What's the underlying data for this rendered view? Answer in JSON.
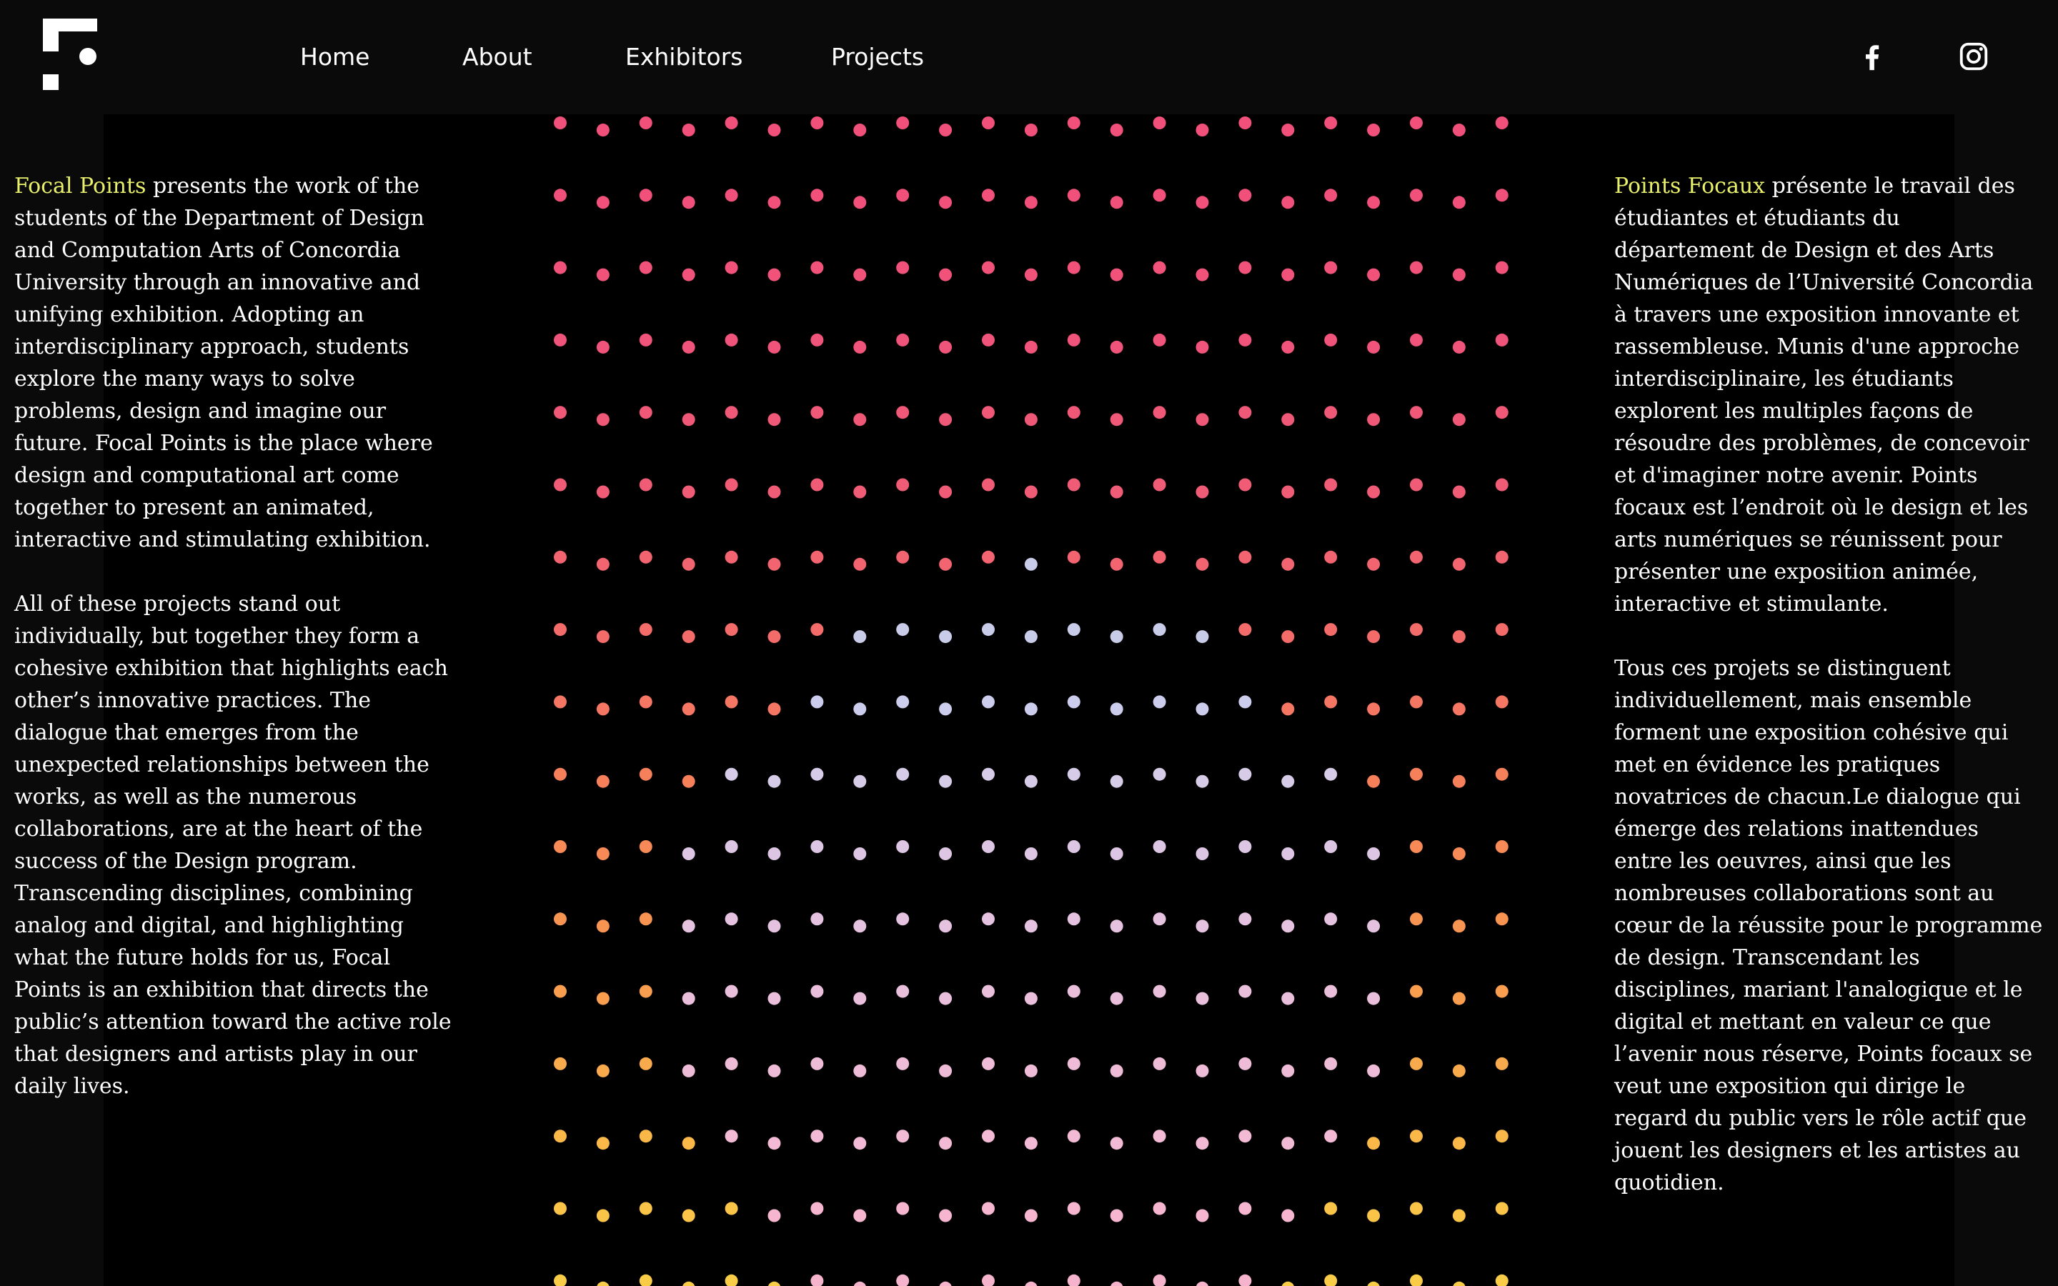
{
  "nav": {
    "logo": "focal-points-logo",
    "links": [
      "Home",
      "About",
      "Exhibitors",
      "Projects"
    ],
    "social": [
      {
        "name": "facebook",
        "icon": "facebook-icon"
      },
      {
        "name": "instagram",
        "icon": "instagram-icon"
      }
    ]
  },
  "left": {
    "highlight": "Focal Points",
    "intro_rest": " presents the work of the students of the Department of Design and Computation Arts of Concordia University through an innovative and unifying exhibition. Adopting an interdisciplinary approach, students explore the many ways to solve problems, design and imagine our future. Focal Points is the place where design and computational art come together to present an animated, interactive and stimulating exhibition.",
    "para2": "All of these projects stand out individually, but together they form a cohesive exhibition that highlights each other’s innovative practices. The dialogue that emerges from the unexpected relationships between the works, as well as the numerous collaborations, are at the heart of the success of the Design program. Transcending disciplines, combining analog and digital, and highlighting what the future holds for us, Focal Points is an exhibition that directs the public’s attention toward the active role that designers and artists play in our daily lives."
  },
  "right": {
    "highlight": "Points Focaux",
    "intro_rest": " présente le travail des étudiantes et étudiants du département de Design et des Arts Numériques de l’Université Concordia à travers une exposition innovante et rassembleuse. Munis d'une approche interdisciplinaire, les étudiants explorent les multiples façons de résoudre des problèmes, de concevoir et d'imaginer notre avenir. Points focaux est l’endroit où le design et les arts numériques se réunissent pour présenter une exposition animée, interactive et stimulante.",
    "para2": "Tous ces projets se distinguent individuellement, mais ensemble forment une exposition cohésive qui met en évidence les pratiques novatrices de chacun.Le dialogue qui émerge des relations inattendues entre les oeuvres, ainsi que les nombreuses collaborations sont au cœur de la réussite pour le programme de design. Transcendant les disciplines, mariant l'analogique et le digital et mettant en valeur ce que l’avenir nous réserve, Points focaux se veut une exposition qui dirige le regard du public vers le rôle actif que jouent les designers et les artistes au quotidien."
  },
  "colors": {
    "background": "#0a0a0a",
    "stage": "#000000",
    "text": "#ffffff",
    "highlight": "#e8f06b",
    "dot_row_colors": [
      "#f0507a",
      "#f0507a",
      "#f0527a",
      "#f0547a",
      "#f05878",
      "#f05c76",
      "#f26470",
      "#f46c6a",
      "#f57662",
      "#f6805a",
      "#f78a56",
      "#f89452",
      "#f89e4e",
      "#f9aa4c",
      "#f9b848",
      "#f9c448",
      "#f9cc48"
    ],
    "dot_center_colors": [
      "#f0507a",
      "#f0507a",
      "#f0527a",
      "#f0547a",
      "#f05878",
      "#f05c76",
      "#c8cce8",
      "#c8cce8",
      "#ccccec",
      "#d6cce8",
      "#dcc6e4",
      "#e4c2e0",
      "#eabfdc",
      "#efbcd8",
      "#f3bad6",
      "#f6b6d0",
      "#f6b4cc"
    ]
  }
}
